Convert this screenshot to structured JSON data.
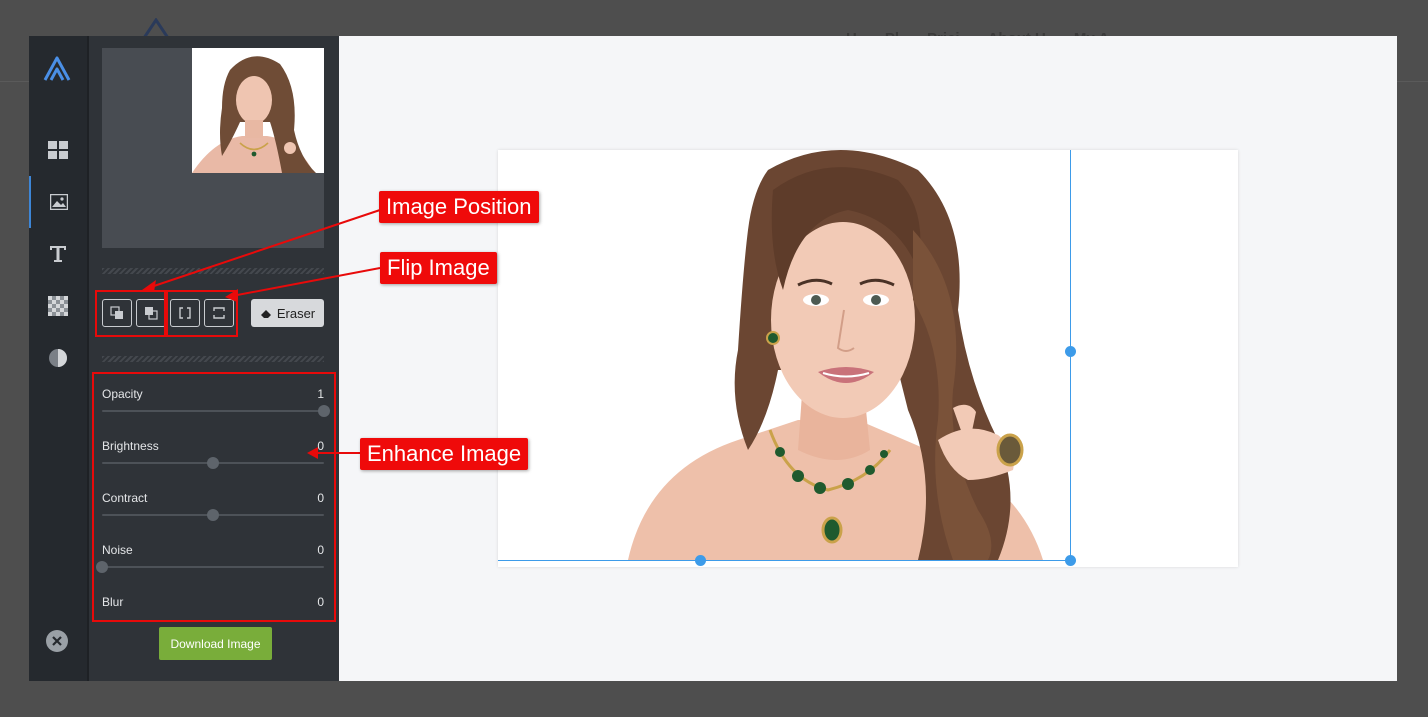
{
  "background_site": {
    "nav": [
      "H",
      "Pl",
      "Prici",
      "About U",
      "My A"
    ]
  },
  "rail": {
    "items": [
      {
        "icon": "dashboard-icon",
        "name": "templates"
      },
      {
        "icon": "image-icon",
        "name": "image",
        "active": true
      },
      {
        "icon": "text-icon",
        "name": "text"
      },
      {
        "icon": "checker-icon",
        "name": "background"
      },
      {
        "icon": "contrast-icon",
        "name": "filters"
      }
    ]
  },
  "panel": {
    "eraser_label": "Eraser",
    "sliders": [
      {
        "label": "Opacity",
        "value": "1",
        "fraction": 1.0
      },
      {
        "label": "Brightness",
        "value": "0",
        "fraction": 0.5
      },
      {
        "label": "Contract",
        "value": "0",
        "fraction": 0.5
      },
      {
        "label": "Noise",
        "value": "0",
        "fraction": 0.0
      },
      {
        "label": "Blur",
        "value": "0"
      }
    ],
    "download_label": "Download Image"
  },
  "annotations": {
    "image_position": "Image Position",
    "flip_image": "Flip Image",
    "enhance_image": "Enhance Image"
  },
  "colors": {
    "accent": "#3d9be9",
    "download": "#79ad3a",
    "annotation": "#ef0a0a"
  }
}
